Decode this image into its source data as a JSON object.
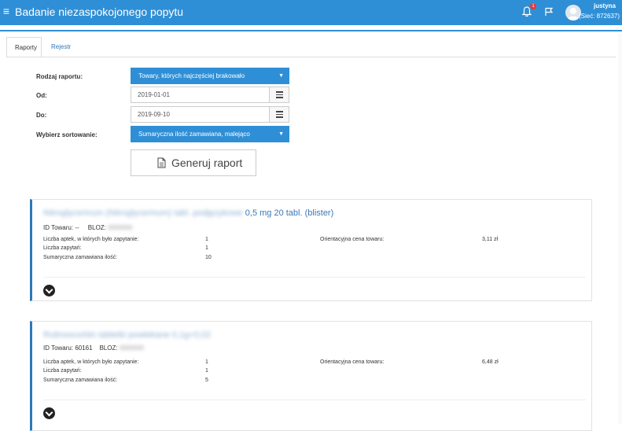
{
  "header": {
    "title": "Badanie niezaspokojonego popytu",
    "notification_count": "1",
    "user_name": "justyna",
    "user_network": "(Sieć: 872637)"
  },
  "tabs": [
    {
      "label": "Raporty",
      "active": true
    },
    {
      "label": "Rejestr",
      "active": false
    }
  ],
  "form": {
    "report_type_label": "Rodzaj raportu:",
    "report_type_value": "Towary, których najczęściej brakowało",
    "from_label": "Od:",
    "from_value": "2019-01-01",
    "to_label": "Do:",
    "to_value": "2019-09-10",
    "sort_label": "Wybierz sortowanie:",
    "sort_value": "Sumaryczna ilość zamawiana, malejąco",
    "generate_button": "Generuj raport"
  },
  "results": [
    {
      "name_hidden": "Nitroglycerinum (Nitroglycerinum) tabl. podjęzykowe",
      "name_visible": "0,5 mg 20 tabl. (blister)",
      "id_label": "ID Towaru:",
      "id_value": "--",
      "bloz_label": "BLOZ:",
      "bloz_value": "0000000",
      "rows": [
        {
          "label": "Liczba aptek, w których było zapytanie:",
          "value": "1"
        },
        {
          "label": "Liczba zapytań:",
          "value": "1"
        },
        {
          "label": "Sumaryczna zamawiana ilość:",
          "value": "10"
        }
      ],
      "price_label": "Orientacyjna cena towaru:",
      "price_value": "3,11 zł"
    },
    {
      "name_hidden": "Rutinoscorbin tabletki powlekane 0,1g+0,02",
      "name_visible": "",
      "id_label": "ID Towaru:",
      "id_value": "60161",
      "bloz_label": "BLOZ:",
      "bloz_value": "0000000",
      "rows": [
        {
          "label": "Liczba aptek, w których było zapytanie:",
          "value": "1"
        },
        {
          "label": "Liczba zapytań:",
          "value": "1"
        },
        {
          "label": "Sumaryczna zamawiana ilość:",
          "value": "5"
        }
      ],
      "price_label": "Orientacyjna cena towaru:",
      "price_value": "6,48 zł"
    }
  ],
  "colors": {
    "primary": "#2f8fd6",
    "link": "#3a78b6",
    "card_accent": "#2f78b8"
  },
  "icons": [
    "hamburger-icon",
    "bell-icon",
    "flag-icon",
    "user-avatar-icon",
    "calendar-icon",
    "document-icon",
    "chevron-down-icon"
  ]
}
